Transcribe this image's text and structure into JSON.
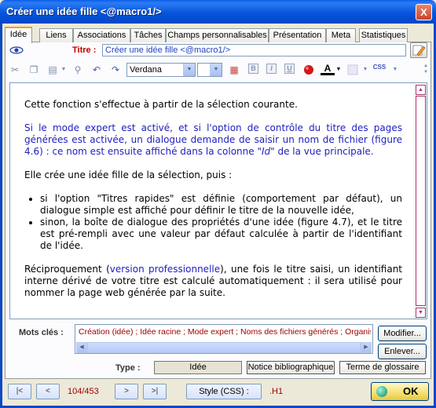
{
  "window": {
    "title": "Créer une idée fille <@macro1/>",
    "close_glyph": "X"
  },
  "tabs": [
    {
      "label": "Idée",
      "active": true
    },
    {
      "label": "Liens"
    },
    {
      "label": "Associations"
    },
    {
      "label": "Tâches"
    },
    {
      "label": "Champs personnalisables"
    },
    {
      "label": "Présentation"
    },
    {
      "label": "Meta"
    },
    {
      "label": "Statistiques"
    }
  ],
  "titre": {
    "label": "Titre :",
    "value": "Créer une idée fille <@macro1/>"
  },
  "toolbar": {
    "font": "Verdana",
    "size": "",
    "bold": "B",
    "italic": "I",
    "underline": "U",
    "text_color_glyph": "A",
    "css_label": "CSS"
  },
  "editor": {
    "p1": "Cette fonction s'effectue à partir de la sélection courante.",
    "p2a": "Si le mode expert est activé, et si l'option de contrôle du titre des pages générées est activée, un dialogue demande de saisir un nom de fichier (figure 4.6) : ce nom est ensuite affiché dans la colonne \"",
    "p2_id": "Id",
    "p2b": "\" de la vue principale.",
    "p3": "Elle crée une idée fille de la sélection, puis :",
    "li1": "si l'option \"Titres rapides\" est définie (comportement par défaut), un dialogue simple est affiché pour définir le titre de la nouvelle idée,",
    "li2": "sinon, la boîte de dialogue des propriétés d'une idée (figure 4.7), et le titre est pré-rempli avec une valeur par défaut calculée à partir de l'identifiant de l'idée.",
    "p4a": "Réciproquement (",
    "p4_link": "version professionnelle",
    "p4b": "), une fois le titre saisi, un identifiant interne dérivé de votre titre est calculé automatiquement : il sera utilisé pour nommer la page web générée par la suite."
  },
  "keywords": {
    "label": "Mots clés :",
    "value": "Création (idée) ; Idée racine ; Mode expert ; Noms des fichiers générés ; Organisation",
    "modify_label": "Modifier...",
    "remove_label": "Enlever..."
  },
  "type": {
    "label": "Type :",
    "options": [
      "Idée",
      "Notice bibliographique",
      "Terme de glossaire"
    ],
    "selected": "Idée"
  },
  "navigation": {
    "first": "|<",
    "prev": "<",
    "page": "104/453",
    "next": ">",
    "last": ">|",
    "style_label": "Style (CSS) :",
    "style_value": ".H1",
    "ok_label": "OK"
  },
  "colors": {
    "accent_titlebar": "#0654db",
    "keyword_text": "#a00000",
    "blue_text": "#2020c0"
  }
}
